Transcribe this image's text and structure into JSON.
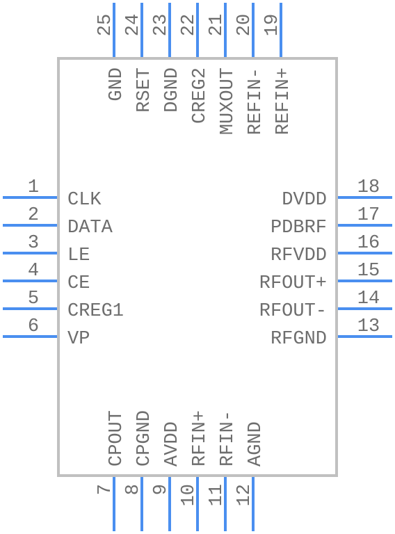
{
  "component": {
    "body_color": "#c0c0c0",
    "pin_color": "#4a8ff0",
    "text_color": "#6e6e6e"
  },
  "pins": {
    "left": [
      {
        "number": "1",
        "name": "CLK"
      },
      {
        "number": "2",
        "name": "DATA"
      },
      {
        "number": "3",
        "name": "LE"
      },
      {
        "number": "4",
        "name": "CE"
      },
      {
        "number": "5",
        "name": "CREG1"
      },
      {
        "number": "6",
        "name": "VP"
      }
    ],
    "bottom": [
      {
        "number": "7",
        "name": "CPOUT"
      },
      {
        "number": "8",
        "name": "CPGND"
      },
      {
        "number": "9",
        "name": "AVDD"
      },
      {
        "number": "10",
        "name": "RFIN+"
      },
      {
        "number": "11",
        "name": "RFIN-"
      },
      {
        "number": "12",
        "name": "AGND"
      }
    ],
    "right": [
      {
        "number": "18",
        "name": "DVDD"
      },
      {
        "number": "17",
        "name": "PDBRF"
      },
      {
        "number": "16",
        "name": "RFVDD"
      },
      {
        "number": "15",
        "name": "RFOUT+"
      },
      {
        "number": "14",
        "name": "RFOUT-"
      },
      {
        "number": "13",
        "name": "RFGND"
      }
    ],
    "top": [
      {
        "number": "25",
        "name": "GND"
      },
      {
        "number": "24",
        "name": "RSET"
      },
      {
        "number": "23",
        "name": "DGND"
      },
      {
        "number": "22",
        "name": "CREG2"
      },
      {
        "number": "21",
        "name": "MUXOUT"
      },
      {
        "number": "20",
        "name": "REFIN-"
      },
      {
        "number": "19",
        "name": "REFIN+"
      }
    ]
  }
}
